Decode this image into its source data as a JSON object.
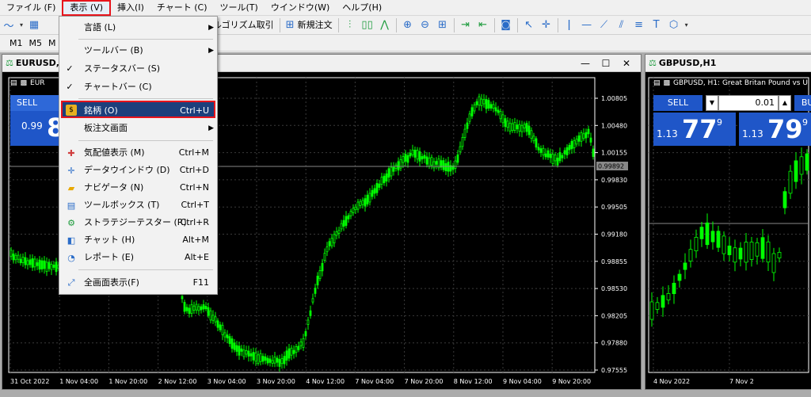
{
  "menubar": {
    "items": [
      {
        "label": "ファイル (F)",
        "open": false
      },
      {
        "label": "表示 (V)",
        "open": true
      },
      {
        "label": "挿入(I)",
        "open": false
      },
      {
        "label": "チャート (C)",
        "open": false
      },
      {
        "label": "ツール(T)",
        "open": false
      },
      {
        "label": "ウインドウ(W)",
        "open": false
      },
      {
        "label": "ヘルプ(H)",
        "open": false
      }
    ]
  },
  "toolbar": {
    "algo_label": "アルゴリズム取引",
    "new_order_label": "新規注文",
    "timeframes": [
      "M1",
      "M5",
      "M"
    ]
  },
  "view_menu": {
    "items": [
      {
        "label": "言語 (L)",
        "shortcut": "",
        "submenu": true,
        "check": "",
        "icon": ""
      },
      {
        "label": "ツールバー (B)",
        "shortcut": "",
        "submenu": true,
        "check": "",
        "icon": ""
      },
      {
        "label": "ステータスバー (S)",
        "shortcut": "",
        "submenu": false,
        "check": "✓",
        "icon": ""
      },
      {
        "label": "チャートバー (C)",
        "shortcut": "",
        "submenu": false,
        "check": "✓",
        "icon": ""
      },
      {
        "label": "銘柄 (O)",
        "shortcut": "Ctrl+U",
        "submenu": false,
        "check": "",
        "icon": "symbols-icon",
        "highlighted": true
      },
      {
        "label": "板注文画面",
        "shortcut": "",
        "submenu": true,
        "check": "",
        "icon": ""
      },
      {
        "label": "気配値表示 (M)",
        "shortcut": "Ctrl+M",
        "submenu": false,
        "check": "",
        "icon": "market-watch-icon"
      },
      {
        "label": "データウインドウ (D)",
        "shortcut": "Ctrl+D",
        "submenu": false,
        "check": "",
        "icon": "data-window-icon"
      },
      {
        "label": "ナビゲータ (N)",
        "shortcut": "Ctrl+N",
        "submenu": false,
        "check": "",
        "icon": "navigator-icon"
      },
      {
        "label": "ツールボックス (T)",
        "shortcut": "Ctrl+T",
        "submenu": false,
        "check": "",
        "icon": "toolbox-icon"
      },
      {
        "label": "ストラテジーテスター (R)",
        "shortcut": "Ctrl+R",
        "submenu": false,
        "check": "",
        "icon": "strategy-tester-icon"
      },
      {
        "label": "チャット (H)",
        "shortcut": "Alt+M",
        "submenu": false,
        "check": "",
        "icon": "chat-icon"
      },
      {
        "label": "レポート (E)",
        "shortcut": "Alt+E",
        "submenu": false,
        "check": "",
        "icon": "report-icon"
      },
      {
        "label": "全画面表示(F)",
        "shortcut": "F11",
        "submenu": false,
        "check": "",
        "icon": "fullscreen-icon"
      }
    ]
  },
  "eurusd": {
    "title": "EURUSD,",
    "panel_label": "EUR",
    "sell_label": "SELL",
    "sell_small": "0.99",
    "sell_big": "8",
    "price_tag": "0.99892",
    "yticks": [
      "1.00805",
      "1.00480",
      "1.00155",
      "0.99830",
      "0.99505",
      "0.99180",
      "0.98855",
      "0.98530",
      "0.98205",
      "0.97880",
      "0.97555"
    ],
    "xticks": [
      "31 Oct 2022",
      "1 Nov 04:00",
      "1 Nov 20:00",
      "2 Nov 12:00",
      "3 Nov 04:00",
      "3 Nov 20:00",
      "4 Nov 12:00",
      "7 Nov 04:00",
      "7 Nov 20:00",
      "8 Nov 12:00",
      "9 Nov 04:00",
      "9 Nov 20:00"
    ]
  },
  "gbpusd": {
    "title": "GBPUSD,H1",
    "panel_label": "GBPUSD, H1:  Great Britan Pound vs U",
    "sell_label": "SELL",
    "buy_label": "BUY",
    "lot": "0.01",
    "sell_small": "1.13",
    "sell_big": "77",
    "sell_sup": "9",
    "buy_small": "1.13",
    "buy_big": "79",
    "buy_sup": "9",
    "xticks": [
      "4 Nov 2022",
      "7 Nov 2"
    ]
  },
  "colors": {
    "bull": "#00ff00",
    "grid": "#3a3a3a",
    "accent": "#e8141c",
    "highlight": "#1c3f7c"
  }
}
